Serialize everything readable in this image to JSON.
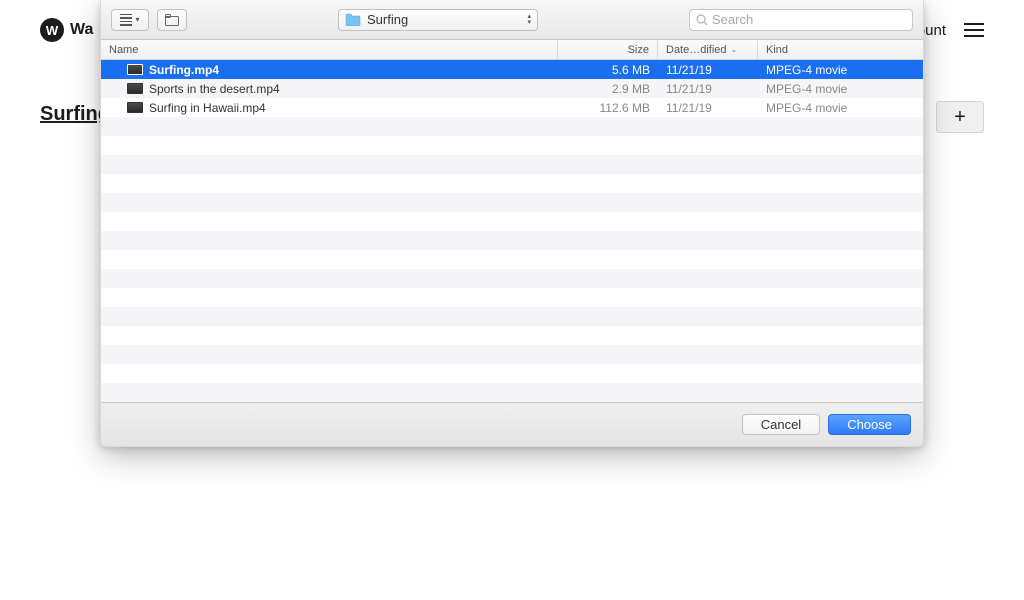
{
  "background": {
    "logo_letter": "W",
    "logo_text": "Wa",
    "account_text": "ount",
    "page_title": "Surfing"
  },
  "dialog": {
    "location": "Surfing",
    "search_placeholder": "Search",
    "columns": {
      "name": "Name",
      "size": "Size",
      "date": "Date…dified",
      "kind": "Kind"
    },
    "files": [
      {
        "name": "Surfing.mp4",
        "size": "5.6 MB",
        "date": "11/21/19",
        "kind": "MPEG-4 movie",
        "selected": true
      },
      {
        "name": "Sports in the desert.mp4",
        "size": "2.9 MB",
        "date": "11/21/19",
        "kind": "MPEG-4 movie",
        "selected": false
      },
      {
        "name": "Surfing in Hawaii.mp4",
        "size": "112.6 MB",
        "date": "11/21/19",
        "kind": "MPEG-4 movie",
        "selected": false
      }
    ],
    "cancel_label": "Cancel",
    "choose_label": "Choose"
  }
}
